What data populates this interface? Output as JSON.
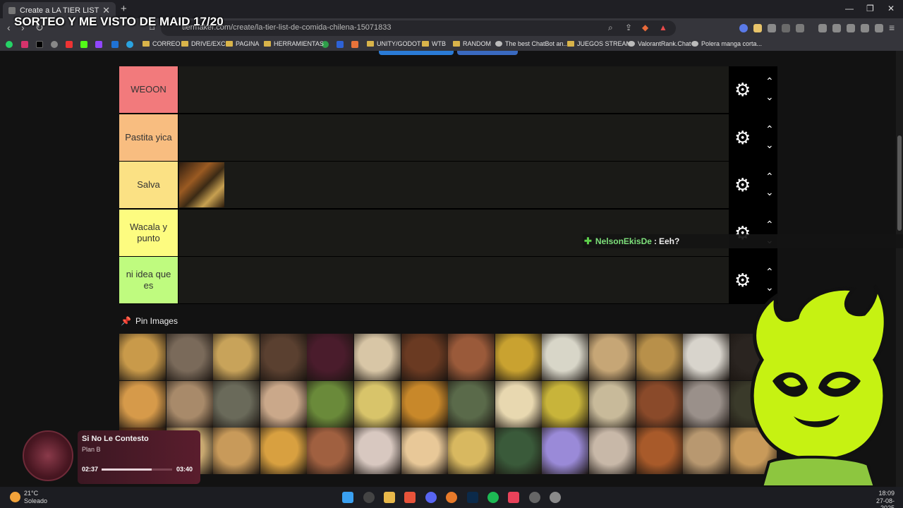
{
  "browser": {
    "tab_title": "Create a LA TIER LIST DE COMIDA",
    "tab_close": "✕",
    "new_tab": "+",
    "url": "tiermaker.com/create/la-tier-list-de-comida-chilena-15071833",
    "window_min": "—",
    "window_max": "❐",
    "window_close": "✕"
  },
  "overlay_title": "SORTEO Y ME VISTO DE MAID 17/20",
  "bookmarks": [
    {
      "label": "CORREO",
      "folder": true
    },
    {
      "label": "DRIVE/EXC",
      "folder": true
    },
    {
      "label": "PAGINA",
      "folder": true
    },
    {
      "label": "HERRAMIENTAS",
      "folder": true
    },
    {
      "label": "UNITY/GODOT",
      "folder": true
    },
    {
      "label": "WTB",
      "folder": true
    },
    {
      "label": "RANDOM",
      "folder": true
    },
    {
      "label": "The best ChatBot an...",
      "folder": false
    },
    {
      "label": "JUEGOS STREAM",
      "folder": true
    },
    {
      "label": "ValorantRank.Chat",
      "folder": false
    },
    {
      "label": "Polera manga corta...",
      "folder": false
    }
  ],
  "tiers": [
    {
      "label": "WEOON",
      "color": "#f27a7c"
    },
    {
      "label": "Pastita yica",
      "color": "#f8bd80"
    },
    {
      "label": "Salva",
      "color": "#fbe184"
    },
    {
      "label": "Wacala y punto",
      "color": "#fdfc80"
    },
    {
      "label": "ni idea que es",
      "color": "#bffb7f"
    }
  ],
  "tier_controls": {
    "gear": "⚙",
    "up": "⌃",
    "down": "⌄"
  },
  "chat": {
    "user": "NelsonEkisDe",
    "separator": ":",
    "message": "Eeh?"
  },
  "pin_images": {
    "title": "Pin Images",
    "pin_icon": "📌"
  },
  "image_grid_colors": [
    "#c99a4a",
    "#7a6a5a",
    "#c8a35a",
    "#5a4030",
    "#4a1c2c",
    "#d8c6a6",
    "#6a3a22",
    "#9a5a3a",
    "#c9a230",
    "#d8d6c8",
    "#c6a676",
    "#b8904a",
    "#d8d4cc",
    "#2a2420",
    "#d69a4a",
    "#a88a6a",
    "#6a6a5a",
    "#caa88a",
    "#6a8a3a",
    "#d8c46a",
    "#c8882a",
    "#5a6a4a",
    "#e8d8b0",
    "#c8b43a",
    "#c8ba9a",
    "#8a4a2a",
    "#9a908a",
    "#3a3a2a",
    "#6a3a1a",
    "#c8a870",
    "#c89a5a",
    "#d8a040",
    "#a06040",
    "#d8c8c0",
    "#e8c898",
    "#d8b860",
    "#3a5a3a",
    "#9a8ad8",
    "#c8b8a8",
    "#a85a2a",
    "#b89870",
    "#c89a5a"
  ],
  "music": {
    "song": "Si No Le Contesto",
    "artist": "Plan B",
    "elapsed": "02:37",
    "total": "03:40",
    "progress": 0.71
  },
  "taskbar": {
    "temp": "21°C",
    "condition": "Soleado",
    "time": "18:09",
    "date": "27-08-2025"
  }
}
